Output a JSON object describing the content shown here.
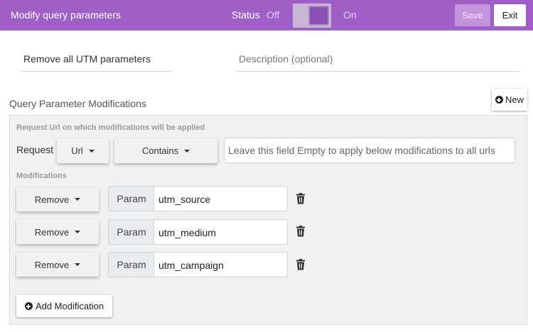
{
  "header": {
    "title": "Modify query parameters",
    "status_label": "Status",
    "off_label": "Off",
    "on_label": "On",
    "status_on": true,
    "save_label": "Save",
    "exit_label": "Exit"
  },
  "rule": {
    "name": "Remove all UTM parameters",
    "description_placeholder": "Description (optional)"
  },
  "section": {
    "title": "Query Parameter Modifications",
    "new_label": "New"
  },
  "request": {
    "heading": "Request Url on which modifications will be applied",
    "label": "Request",
    "source": "Url",
    "operator": "Contains",
    "value_placeholder": "Leave this field Empty to apply below modifications to all urls"
  },
  "modifications": {
    "heading": "Modifications",
    "items": [
      {
        "action": "Remove",
        "addon": "Param",
        "param": "utm_source",
        "icon": "trash-icon"
      },
      {
        "action": "Remove",
        "addon": "Param",
        "param": "utm_medium",
        "icon": "trash-icon"
      },
      {
        "action": "Remove",
        "addon": "Param",
        "param": "utm_campaign",
        "icon": "trash-icon"
      }
    ],
    "add_label": "Add Modification"
  },
  "colors": {
    "header_bg": "#a05fc7",
    "toggle_knob": "#8a50b3",
    "save_bg": "#c493e0",
    "panel_bg": "#f1f1f1"
  }
}
